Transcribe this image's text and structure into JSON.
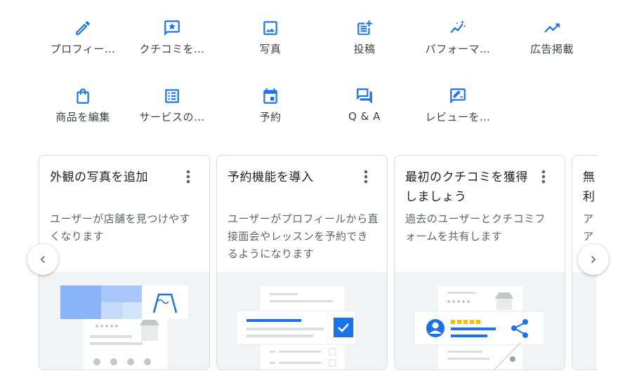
{
  "actions_row1": [
    {
      "label": "プロフィー…",
      "icon": "pencil-icon"
    },
    {
      "label": "クチコミを…",
      "icon": "review-star-icon"
    },
    {
      "label": "写真",
      "icon": "photo-icon"
    },
    {
      "label": "投稿",
      "icon": "post-add-icon"
    },
    {
      "label": "パフォーマ…",
      "icon": "sparkle-chart-icon"
    },
    {
      "label": "広告掲載",
      "icon": "trending-up-icon"
    }
  ],
  "actions_row2": [
    {
      "label": "商品を編集",
      "icon": "shopping-bag-icon"
    },
    {
      "label": "サービスの…",
      "icon": "service-list-icon"
    },
    {
      "label": "予約",
      "icon": "calendar-icon"
    },
    {
      "label": "Q & A",
      "icon": "qa-bubble-icon"
    },
    {
      "label": "レビューを…",
      "icon": "rate-review-icon"
    }
  ],
  "cards": [
    {
      "title": "外観の写真を追加",
      "description": "ユーザーが店舗を見つけやすくなります"
    },
    {
      "title": "予約機能を導入",
      "description": "ユーザーがプロフィールから直接面会やレッスンを予約できるようになります"
    },
    {
      "title": "最初のクチコミを獲得しましょう",
      "description": "過去のユーザーとクチコミフォームを共有します"
    },
    {
      "title": "無利",
      "description": "アア"
    }
  ],
  "colors": {
    "accent": "#1a73e8",
    "text": "#3c4043",
    "muted": "#5f6368",
    "border": "#dadce0",
    "illustration_bg": "#f1f3f4"
  }
}
